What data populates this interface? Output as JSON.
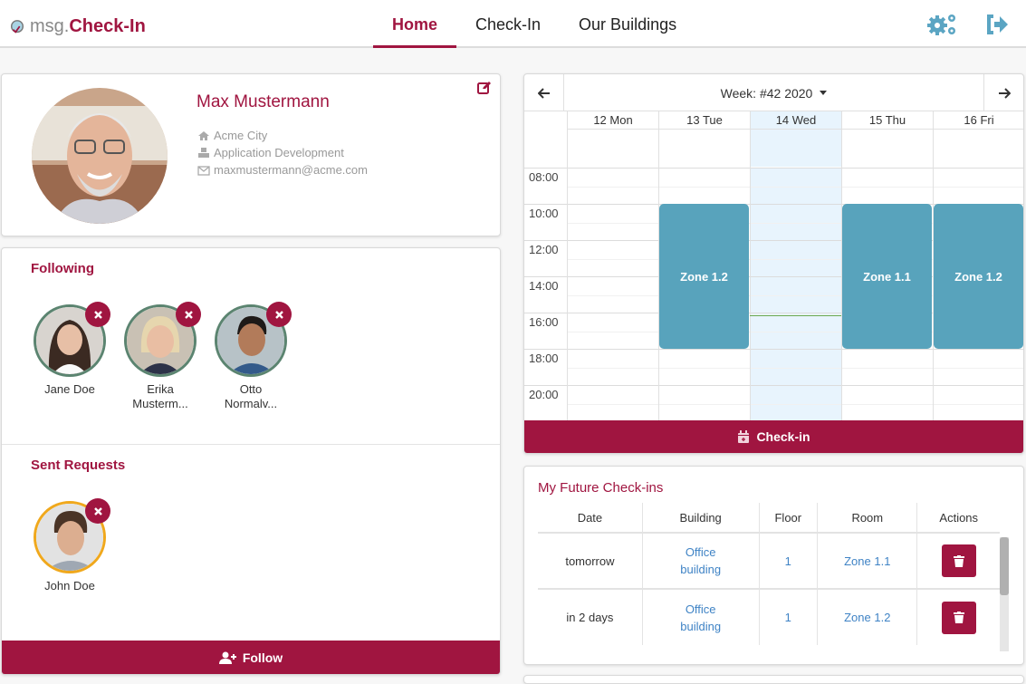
{
  "app": {
    "logo_prefix": "msg.",
    "logo_name": "Check-In"
  },
  "nav": {
    "items": [
      {
        "label": "Home",
        "active": true
      },
      {
        "label": "Check-In",
        "active": false
      },
      {
        "label": "Our Buildings",
        "active": false
      }
    ]
  },
  "header_icons": {
    "settings": "gears-icon",
    "logout": "sign-out-icon"
  },
  "profile": {
    "name": "Max Mustermann",
    "location": "Acme City",
    "department": "Application Development",
    "email": "maxmustermann@acme.com"
  },
  "following": {
    "title": "Following",
    "people": [
      {
        "name_line1": "Jane Doe",
        "name_line2": ""
      },
      {
        "name_line1": "Erika",
        "name_line2": "Musterm..."
      },
      {
        "name_line1": "Otto",
        "name_line2": "Normalv..."
      }
    ]
  },
  "sent_requests": {
    "title": "Sent Requests",
    "people": [
      {
        "name_line1": "John Doe",
        "name_line2": ""
      }
    ]
  },
  "follow_button": "Follow",
  "calendar": {
    "week_label": "Week: #42 2020",
    "days": [
      "12 Mon",
      "13 Tue",
      "14 Wed",
      "15 Thu",
      "16 Fri"
    ],
    "today_index": 2,
    "hours": [
      "08:00",
      "10:00",
      "12:00",
      "14:00",
      "16:00",
      "18:00",
      "20:00"
    ],
    "events": [
      {
        "day_index": 1,
        "label": "Zone 1.2",
        "start": "10:00",
        "end": "18:00"
      },
      {
        "day_index": 3,
        "label": "Zone 1.1",
        "start": "10:00",
        "end": "18:00"
      },
      {
        "day_index": 4,
        "label": "Zone 1.2",
        "start": "10:00",
        "end": "18:00"
      }
    ],
    "now_time": "16:10",
    "checkin_button": "Check-in"
  },
  "future_checkins": {
    "title": "My Future Check-ins",
    "columns": [
      "Date",
      "Building",
      "Floor",
      "Room",
      "Actions"
    ],
    "rows": [
      {
        "date": "tomorrow",
        "building": "Office building",
        "floor": "1",
        "room": "Zone 1.1"
      },
      {
        "date": "in 2 days",
        "building": "Office building",
        "floor": "1",
        "room": "Zone 1.2"
      }
    ]
  },
  "colors": {
    "brand": "#a01540",
    "event": "#58a3bc",
    "today": "#e8f4fd",
    "following_ring": "#5b8470",
    "pending_ring": "#f0a81c",
    "link": "#3f83c5",
    "icon_blue": "#5ba5c3"
  }
}
